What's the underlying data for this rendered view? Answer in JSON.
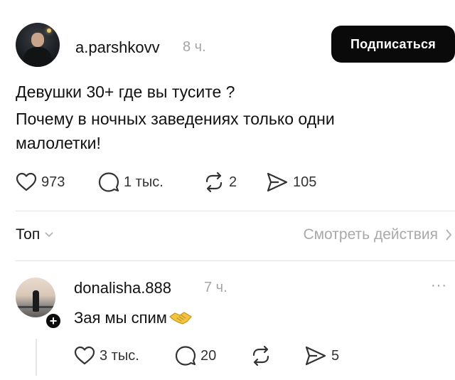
{
  "post": {
    "username": "a.parshkovv",
    "time": "8 ч.",
    "follow_label": "Подписаться",
    "text_line1": "Девушки 30+ где вы тусите ?",
    "text_line2": "Почему в ночных заведениях только  одни",
    "text_line3": "малолетки!",
    "likes": "973",
    "replies": "1 тыс.",
    "reposts": "2",
    "shares": "105"
  },
  "sort": {
    "label": "Топ",
    "view_activity_label": "Смотреть действия"
  },
  "comment": {
    "username": "donalisha.888",
    "time": "7 ч.",
    "more": "···",
    "text": "Зая мы спим",
    "emoji": "handshake",
    "likes": "3 тыс.",
    "replies": "20",
    "reposts": "",
    "shares": "5"
  },
  "icons": [
    "heart-icon",
    "comment-icon",
    "repost-icon",
    "share-icon",
    "chevron-down-icon",
    "chevron-right-icon",
    "plus-icon",
    "more-icon"
  ]
}
